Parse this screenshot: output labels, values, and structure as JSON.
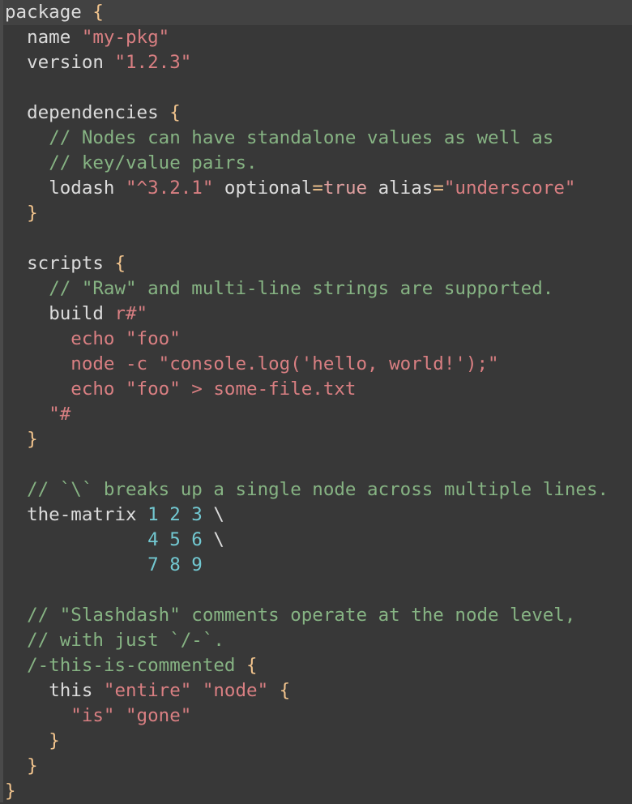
{
  "editor": {
    "language": "KDL",
    "current_line": 0,
    "colors": {
      "background": "#383838",
      "identifier": "#dcdcdc",
      "string": "#d97f82",
      "brace": "#f2c48d",
      "comment": "#86b383",
      "number": "#72c8d1"
    },
    "lines": [
      [
        [
          "ident",
          "package "
        ],
        [
          "brace",
          "{"
        ]
      ],
      [
        [
          "plain",
          "  "
        ],
        [
          "ident",
          "name "
        ],
        [
          "str",
          "\"my-pkg\""
        ]
      ],
      [
        [
          "plain",
          "  "
        ],
        [
          "ident",
          "version "
        ],
        [
          "str",
          "\"1.2.3\""
        ]
      ],
      [],
      [
        [
          "plain",
          "  "
        ],
        [
          "ident",
          "dependencies "
        ],
        [
          "brace",
          "{"
        ]
      ],
      [
        [
          "plain",
          "    "
        ],
        [
          "cmt",
          "// Nodes can have standalone values as well as"
        ]
      ],
      [
        [
          "plain",
          "    "
        ],
        [
          "cmt",
          "// key/value pairs."
        ]
      ],
      [
        [
          "plain",
          "    "
        ],
        [
          "ident",
          "lodash "
        ],
        [
          "str",
          "\"^3.2.1\""
        ],
        [
          "ident",
          " optional"
        ],
        [
          "op",
          "="
        ],
        [
          "kw",
          "true"
        ],
        [
          "ident",
          " alias"
        ],
        [
          "op",
          "="
        ],
        [
          "str",
          "\"underscore\""
        ]
      ],
      [
        [
          "plain",
          "  "
        ],
        [
          "brace",
          "}"
        ]
      ],
      [],
      [
        [
          "plain",
          "  "
        ],
        [
          "ident",
          "scripts "
        ],
        [
          "brace",
          "{"
        ]
      ],
      [
        [
          "plain",
          "    "
        ],
        [
          "cmt",
          "// \"Raw\" and multi-line strings are supported."
        ]
      ],
      [
        [
          "plain",
          "    "
        ],
        [
          "ident",
          "build "
        ],
        [
          "str",
          "r#\""
        ]
      ],
      [
        [
          "plain",
          "      "
        ],
        [
          "str",
          "echo \"foo\""
        ]
      ],
      [
        [
          "plain",
          "      "
        ],
        [
          "str",
          "node -c \"console.log('hello, world!');\""
        ]
      ],
      [
        [
          "plain",
          "      "
        ],
        [
          "str",
          "echo \"foo\" > some-file.txt"
        ]
      ],
      [
        [
          "plain",
          "    "
        ],
        [
          "str",
          "\"#"
        ]
      ],
      [
        [
          "plain",
          "  "
        ],
        [
          "brace",
          "}"
        ]
      ],
      [],
      [
        [
          "plain",
          "  "
        ],
        [
          "cmt",
          "// `\\` breaks up a single node across multiple lines."
        ]
      ],
      [
        [
          "plain",
          "  "
        ],
        [
          "ident",
          "the-matrix "
        ],
        [
          "num",
          "1 2 3"
        ],
        [
          "plain",
          " \\"
        ]
      ],
      [
        [
          "plain",
          "             "
        ],
        [
          "num",
          "4 5 6"
        ],
        [
          "plain",
          " \\"
        ]
      ],
      [
        [
          "plain",
          "             "
        ],
        [
          "num",
          "7 8 9"
        ]
      ],
      [],
      [
        [
          "plain",
          "  "
        ],
        [
          "cmt",
          "// \"Slashdash\" comments operate at the node level,"
        ]
      ],
      [
        [
          "plain",
          "  "
        ],
        [
          "cmt",
          "// with just `/-`."
        ]
      ],
      [
        [
          "plain",
          "  "
        ],
        [
          "cmt",
          "/-this-is-commented "
        ],
        [
          "brace",
          "{"
        ]
      ],
      [
        [
          "plain",
          "    "
        ],
        [
          "ident",
          "this "
        ],
        [
          "str",
          "\"entire\" \"node\" "
        ],
        [
          "brace",
          "{"
        ]
      ],
      [
        [
          "plain",
          "      "
        ],
        [
          "str",
          "\"is\" \"gone\""
        ]
      ],
      [
        [
          "plain",
          "    "
        ],
        [
          "brace",
          "}"
        ]
      ],
      [
        [
          "plain",
          "  "
        ],
        [
          "brace",
          "}"
        ]
      ],
      [
        [
          "brace",
          "}"
        ]
      ]
    ]
  }
}
